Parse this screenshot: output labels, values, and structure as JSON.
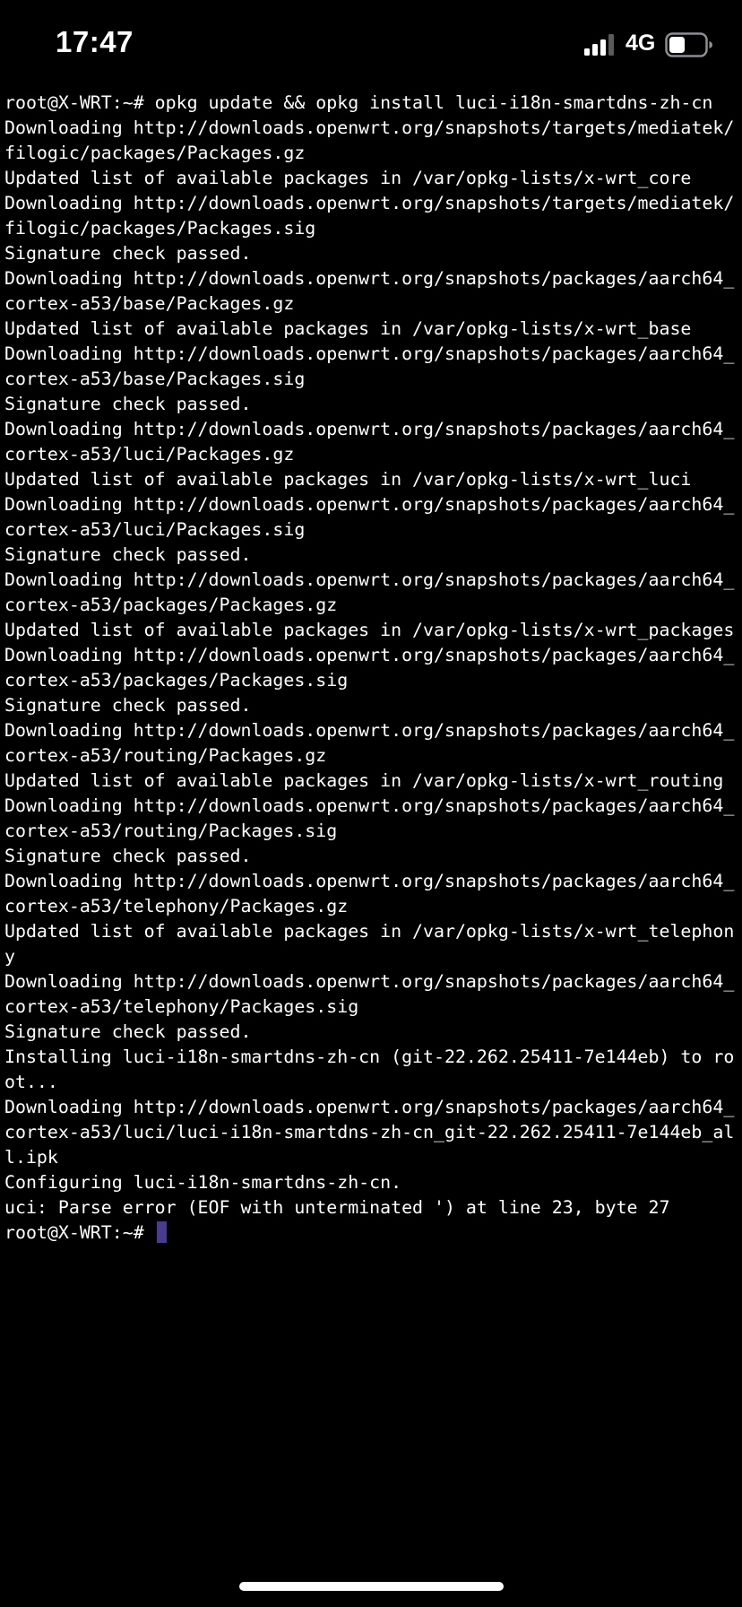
{
  "status_bar": {
    "time": "17:47",
    "network": "4G",
    "icons": [
      "cellular-signal-icon",
      "battery-icon"
    ]
  },
  "terminal": {
    "lines": [
      "root@X-WRT:~# opkg update && opkg install luci-i18n-smartdns-zh-cn",
      "Downloading http://downloads.openwrt.org/snapshots/targets/mediatek/",
      "filogic/packages/Packages.gz",
      "Updated list of available packages in /var/opkg-lists/x-wrt_core",
      "Downloading http://downloads.openwrt.org/snapshots/targets/mediatek/",
      "filogic/packages/Packages.sig",
      "Signature check passed.",
      "Downloading http://downloads.openwrt.org/snapshots/packages/aarch64_",
      "cortex-a53/base/Packages.gz",
      "Updated list of available packages in /var/opkg-lists/x-wrt_base",
      "Downloading http://downloads.openwrt.org/snapshots/packages/aarch64_",
      "cortex-a53/base/Packages.sig",
      "Signature check passed.",
      "Downloading http://downloads.openwrt.org/snapshots/packages/aarch64_",
      "cortex-a53/luci/Packages.gz",
      "Updated list of available packages in /var/opkg-lists/x-wrt_luci",
      "Downloading http://downloads.openwrt.org/snapshots/packages/aarch64_",
      "cortex-a53/luci/Packages.sig",
      "Signature check passed.",
      "Downloading http://downloads.openwrt.org/snapshots/packages/aarch64_",
      "cortex-a53/packages/Packages.gz",
      "Updated list of available packages in /var/opkg-lists/x-wrt_packages",
      "Downloading http://downloads.openwrt.org/snapshots/packages/aarch64_",
      "cortex-a53/packages/Packages.sig",
      "Signature check passed.",
      "Downloading http://downloads.openwrt.org/snapshots/packages/aarch64_",
      "cortex-a53/routing/Packages.gz",
      "Updated list of available packages in /var/opkg-lists/x-wrt_routing",
      "Downloading http://downloads.openwrt.org/snapshots/packages/aarch64_",
      "cortex-a53/routing/Packages.sig",
      "Signature check passed.",
      "Downloading http://downloads.openwrt.org/snapshots/packages/aarch64_",
      "cortex-a53/telephony/Packages.gz",
      "Updated list of available packages in /var/opkg-lists/x-wrt_telephon",
      "y",
      "Downloading http://downloads.openwrt.org/snapshots/packages/aarch64_",
      "cortex-a53/telephony/Packages.sig",
      "Signature check passed.",
      "Installing luci-i18n-smartdns-zh-cn (git-22.262.25411-7e144eb) to ro",
      "ot...",
      "Downloading http://downloads.openwrt.org/snapshots/packages/aarch64_",
      "cortex-a53/luci/luci-i18n-smartdns-zh-cn_git-22.262.25411-7e144eb_al",
      "l.ipk",
      "Configuring luci-i18n-smartdns-zh-cn.",
      "uci: Parse error (EOF with unterminated ') at line 23, byte 27"
    ],
    "prompt": "root@X-WRT:~# ",
    "cursor_color": "#4b3b8f",
    "text_color": "#ffffff",
    "background_color": "#000000"
  }
}
